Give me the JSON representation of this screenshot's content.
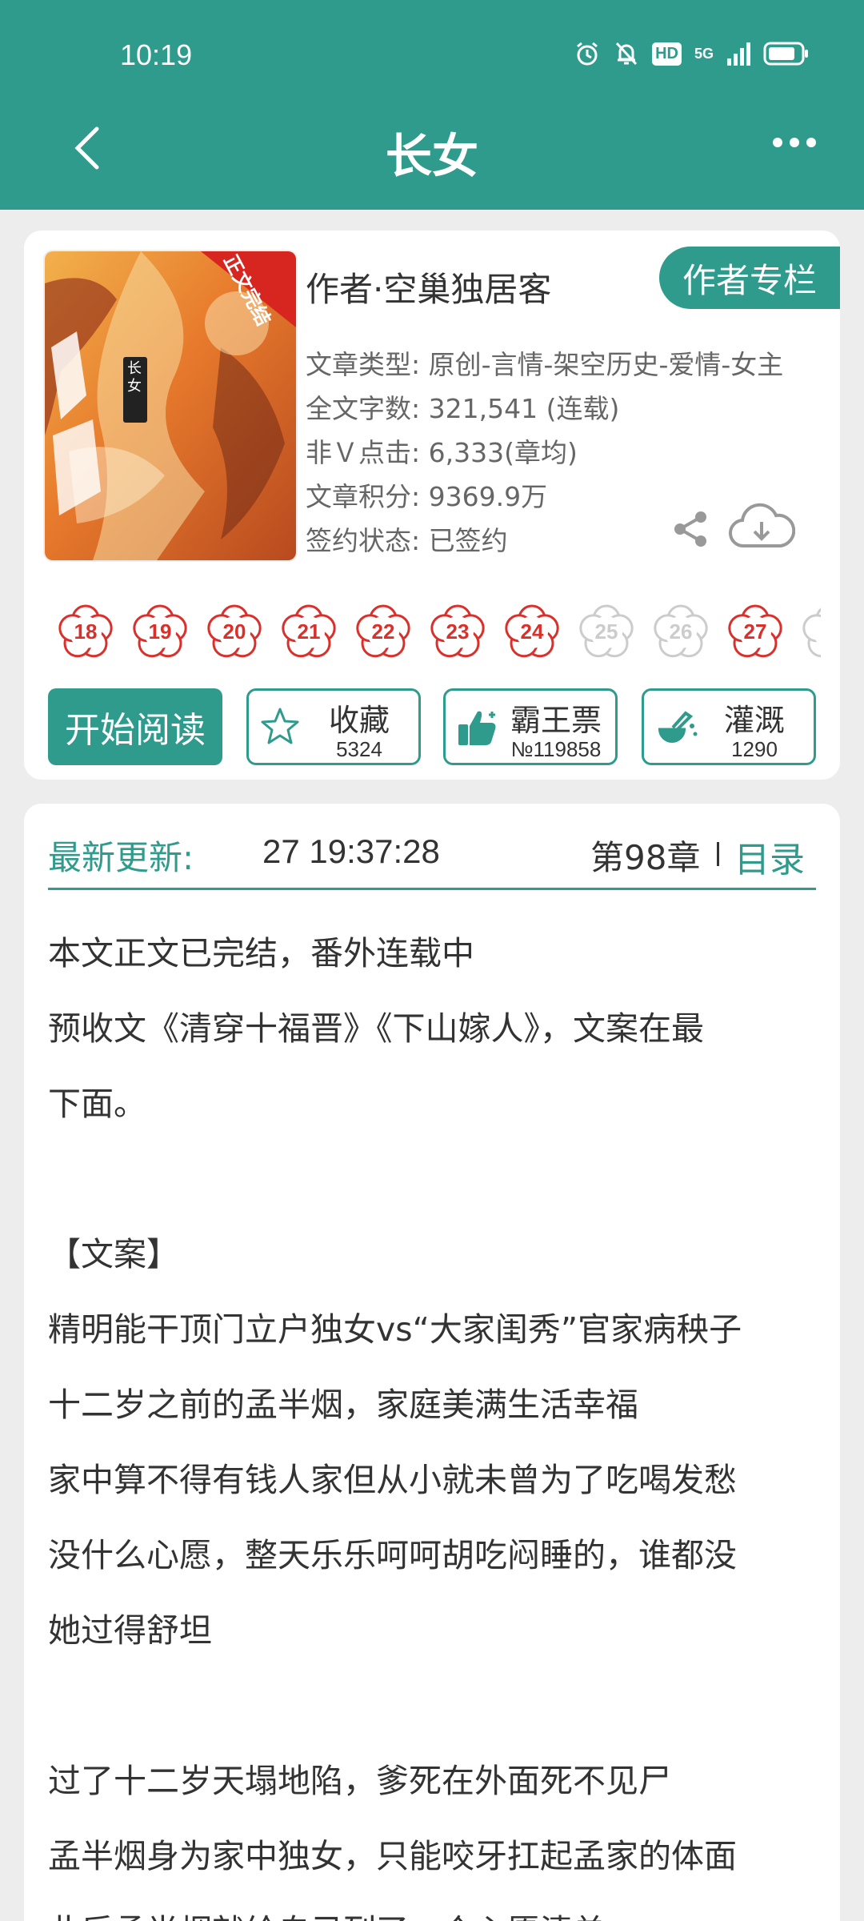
{
  "status_bar": {
    "time": "10:19",
    "hd": "HD",
    "network": "5G"
  },
  "header": {
    "title": "长女"
  },
  "book": {
    "cover_badge": "正文完结",
    "cover_title": "长女",
    "author_line": "作者·空巢独居客",
    "author_column_label": "作者专栏",
    "meta": [
      {
        "key": "文章类型:",
        "value": "原创-言情-架空历史-爱情-女主"
      },
      {
        "key": "全文字数:",
        "value": "321,541 (连载)"
      },
      {
        "key": "非Ｖ点击:",
        "value": "6,333(章均)"
      },
      {
        "key": "文章积分:",
        "value": "9369.9万"
      },
      {
        "key": "签约状态:",
        "value": "已签约"
      }
    ]
  },
  "flowers": [
    {
      "n": "18",
      "state": "active"
    },
    {
      "n": "19",
      "state": "active"
    },
    {
      "n": "20",
      "state": "active"
    },
    {
      "n": "21",
      "state": "active"
    },
    {
      "n": "22",
      "state": "active"
    },
    {
      "n": "23",
      "state": "active"
    },
    {
      "n": "24",
      "state": "active"
    },
    {
      "n": "25",
      "state": "inactive"
    },
    {
      "n": "26",
      "state": "inactive"
    },
    {
      "n": "27",
      "state": "active"
    },
    {
      "n": "",
      "state": "inactive"
    }
  ],
  "actions": {
    "start_reading": "开始阅读",
    "collect": {
      "label": "收藏",
      "count": "5324",
      "icon": "star-icon"
    },
    "ticket": {
      "label": "霸王票",
      "count": "№119858",
      "icon": "thumbs-up-icon"
    },
    "water": {
      "label": "灌溉",
      "count": "1290",
      "icon": "watering-icon"
    }
  },
  "update": {
    "label": "最新更新:",
    "time": "27 19:37:28",
    "chapter": "第98章",
    "toc": "目录"
  },
  "description": [
    "本文正文已完结，番外连载中",
    "预收文《清穿十福晋》《下山嫁人》，文案在最",
    "下面。",
    "",
    "【文案】",
    "精明能干顶门立户独女vs“大家闺秀”官家病秧子",
    "十二岁之前的孟半烟，家庭美满生活幸福",
    "家中算不得有钱人家但从小就未曾为了吃喝发愁",
    "没什么心愿，整天乐乐呵呵胡吃闷睡的，谁都没",
    "她过得舒坦",
    "",
    "过了十二岁天塌地陷，爹死在外面死不见尸",
    "孟半烟身为家中独女，只能咬牙扛起孟家的体面",
    "此后孟半烟就给自己列了一个心愿清单"
  ],
  "colors": {
    "accent": "#2f9b8c",
    "flower_active": "#d9302c",
    "flower_inactive": "#cccccc"
  }
}
